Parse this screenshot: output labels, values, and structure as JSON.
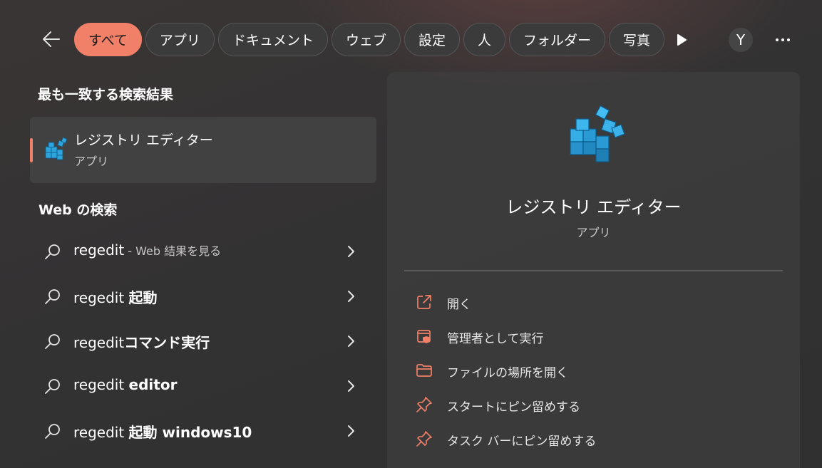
{
  "nav": {
    "tabs": [
      {
        "label": "すべて",
        "active": true
      },
      {
        "label": "アプリ",
        "active": false
      },
      {
        "label": "ドキュメント",
        "active": false
      },
      {
        "label": "ウェブ",
        "active": false
      },
      {
        "label": "設定",
        "active": false
      },
      {
        "label": "人",
        "active": false
      },
      {
        "label": "フォルダー",
        "active": false
      },
      {
        "label": "写真",
        "active": false
      }
    ],
    "avatar_letter": "Y",
    "icons": {
      "back": "arrow-left-icon",
      "play": "play-icon",
      "more": "more-icon"
    }
  },
  "best_match": {
    "heading": "最も一致する検索結果",
    "name": "レジストリ エディター",
    "type": "アプリ"
  },
  "web": {
    "heading": "Web の検索",
    "rows": [
      {
        "query": "regedit",
        "bold": "",
        "hint": " - Web 結果を見る"
      },
      {
        "query": "regedit ",
        "bold": "起動",
        "hint": ""
      },
      {
        "query": "regedit",
        "bold": "コマンド実行",
        "hint": ""
      },
      {
        "query": "regedit ",
        "bold": "editor",
        "hint": ""
      },
      {
        "query": "regedit ",
        "bold": "起動 windows10",
        "hint": ""
      }
    ]
  },
  "detail": {
    "title": "レジストリ エディター",
    "subtitle": "アプリ",
    "actions": [
      {
        "label": "開く",
        "icon": "open-external-icon"
      },
      {
        "label": "管理者として実行",
        "icon": "run-as-admin-icon"
      },
      {
        "label": "ファイルの場所を開く",
        "icon": "folder-icon"
      },
      {
        "label": "スタートにピン留めする",
        "icon": "pin-icon"
      },
      {
        "label": "タスク バーにピン留めする",
        "icon": "pin-icon"
      }
    ]
  },
  "colors": {
    "accent": "#f08068",
    "background": "#333233"
  }
}
